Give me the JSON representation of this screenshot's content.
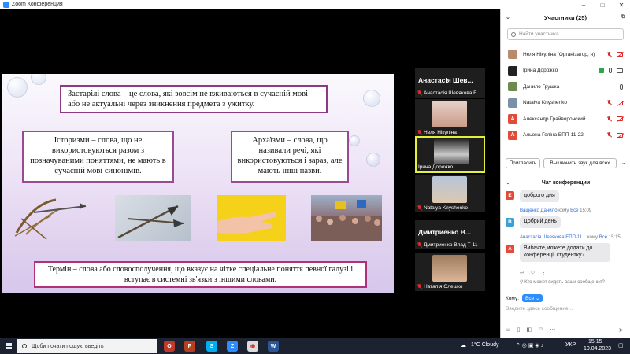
{
  "window": {
    "title": "Zoom Конференция",
    "min_icon": "minimize-icon",
    "max_icon": "maximize-icon",
    "close_icon": "close-icon"
  },
  "slide": {
    "definition": "Застарілі слова – це слова, які зовсім не вживаються в сучасній мові або не актуальні через зникнення предмета з ужитку.",
    "historisms": "Історизми – слова, що не використовуються разом з позначуваними поняттями, не мають в сучасній мові синонімів.",
    "archaisms": "Архаїзми – слова, що називали речі, які використовуються і зараз, але мають інші назви.",
    "term": "Термін – слова або словосполучення, що вказує на чітке спеціальне поняття певної галузі і вступає в системні зв'язки з іншими словами."
  },
  "gallery": {
    "tiles": [
      {
        "name": "Анастасія Шев...",
        "label": "Анастасія Шевякова Е...",
        "type": "name"
      },
      {
        "label": "Неля Нікуліна",
        "type": "photo"
      },
      {
        "label": "Ірина Дорожко",
        "type": "photo"
      },
      {
        "label": "Natalya Knyshenko",
        "type": "photo"
      },
      {
        "name": "Дмитриенко В...",
        "label": "Дмитриенко Влад Т-11",
        "type": "name"
      },
      {
        "label": "Наталія Олешко",
        "type": "photo"
      }
    ]
  },
  "participants": {
    "title": "Участники (25)",
    "search_placeholder": "Найти участника",
    "list": [
      {
        "name": "Неля Нікуліна (Організатор, я)",
        "avatar": "photo",
        "color": "#b98b6e"
      },
      {
        "name": "Ірина Дорожко",
        "avatar": "photo",
        "color": "#222222"
      },
      {
        "name": "Данило Грушка",
        "avatar": "photo",
        "color": "#6d8b4d"
      },
      {
        "name": "Natalya Knyshenko",
        "avatar": "photo",
        "color": "#7a8fa8"
      },
      {
        "name": "Александр Грайворонский",
        "avatar": "А",
        "color": "#e04b3a"
      },
      {
        "name": "Альона Геліна ЕПП-11-22",
        "avatar": "А",
        "color": "#e04b3a"
      }
    ],
    "invite_label": "Пригласить",
    "mute_all_label": "Выключить звук для всех"
  },
  "chat": {
    "title": "Чат конференции",
    "messages": [
      {
        "avatar": "Е",
        "color": "#e04b3a",
        "text": "доброго дня"
      },
      {
        "avatar": "В",
        "color": "#3aa1d0",
        "sender": "Ващенко Данило",
        "to": "кому",
        "target": "Все",
        "time": "15:09",
        "text": "Добрий день"
      },
      {
        "avatar": "А",
        "color": "#e04b3a",
        "sender": "Анастасія Шевякова ЕПП-11...",
        "to": "кому",
        "target": "Все",
        "time": "15:15",
        "text": "Вибачте,можете додати до конференції студентку?"
      }
    ],
    "who_sees": "Кто может видеть ваши сообщения?",
    "to_label": "Кому:",
    "to_value": "Все",
    "input_placeholder": "Введите здесь сообщение..."
  },
  "taskbar": {
    "search_placeholder": "Щоби почати пошук, введіть",
    "weather": "1°C  Cloudy",
    "lang": "УКР",
    "time": "15:15",
    "date": "10.04.2023"
  }
}
